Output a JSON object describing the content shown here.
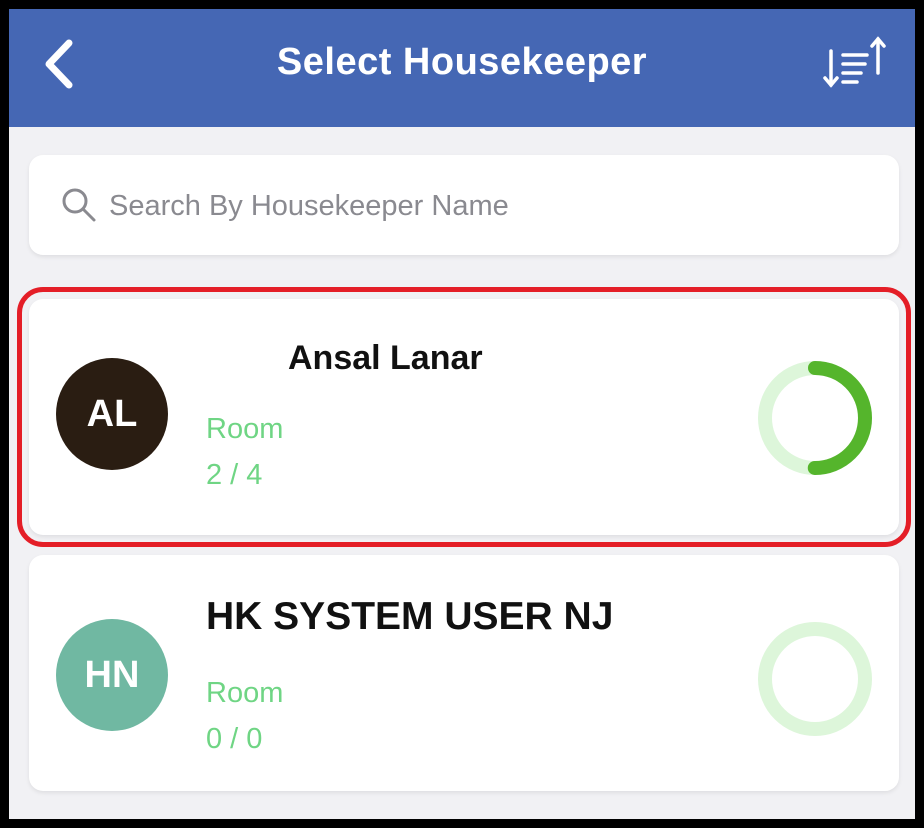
{
  "header": {
    "title": "Select Housekeeper",
    "background": "#4567b4",
    "back_icon": "chevron-left-icon",
    "sort_icon": "sort-icon"
  },
  "search": {
    "placeholder": "Search By Housekeeper Name",
    "value": "",
    "icon": "search-icon"
  },
  "housekeepers": [
    {
      "initials": "AL",
      "name": "Ansal Lanar",
      "room_label": "Room",
      "room_count": "2 / 4",
      "completed": 2,
      "total": 4,
      "avatar_color": "#2a1d12",
      "selected": true
    },
    {
      "initials": "HN",
      "name": "HK SYSTEM USER NJ",
      "room_label": "Room",
      "room_count": "0 / 0",
      "completed": 0,
      "total": 0,
      "avatar_color": "#70b8a2",
      "selected": false
    }
  ],
  "colors": {
    "progress_track": "#ddf6da",
    "progress_fill": "#55b52c",
    "room_text": "#6fd584",
    "selection_border": "#e41e27"
  }
}
